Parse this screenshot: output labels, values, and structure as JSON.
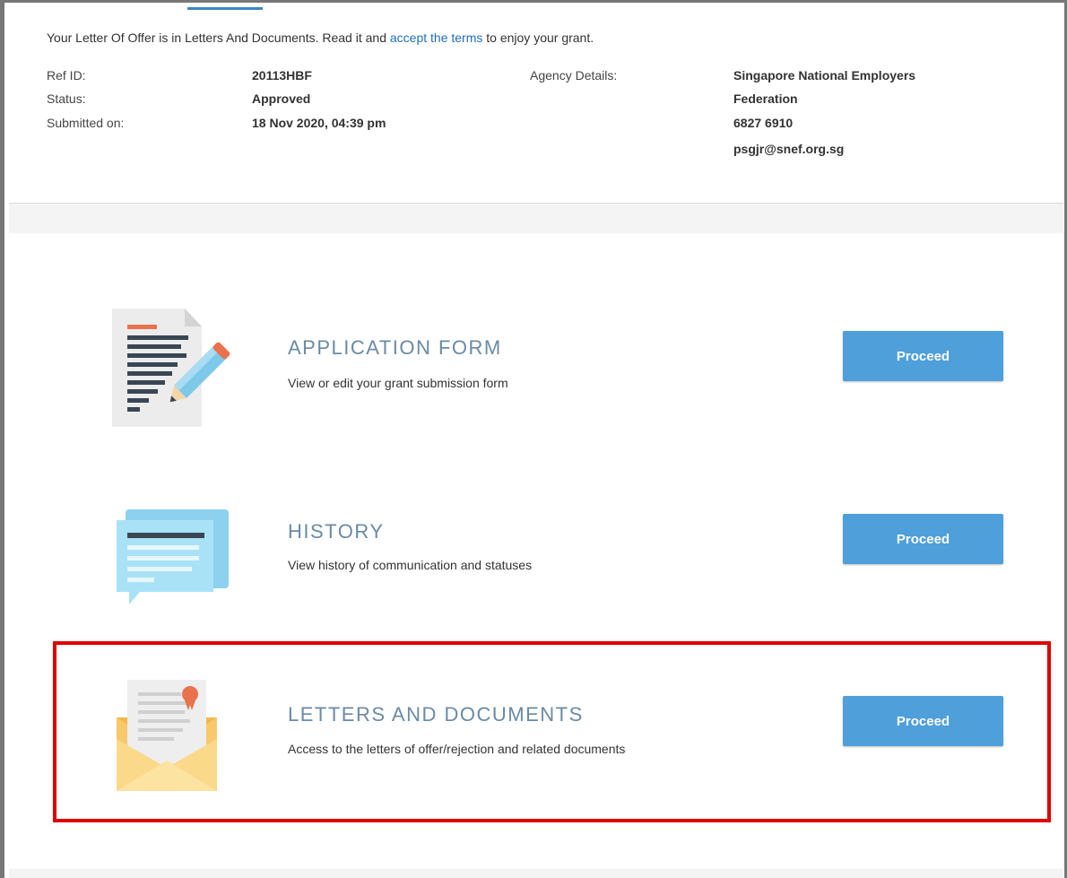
{
  "notice": {
    "prefix": "Your Letter Of Offer is in Letters And Documents. Read it and ",
    "link": "accept the terms",
    "suffix": " to enjoy your grant."
  },
  "details": {
    "ref_label": "Ref ID:",
    "ref_value": "20113HBF",
    "status_label": "Status:",
    "status_value": "Approved",
    "submitted_label": "Submitted on:",
    "submitted_value": "18 Nov 2020, 04:39 pm",
    "agency_label": "Agency Details:",
    "agency_name_line1": "Singapore National Employers",
    "agency_name_line2": "Federation",
    "agency_phone": "6827 6910",
    "agency_email": "psgjr@snef.org.sg"
  },
  "items": [
    {
      "title": "APPLICATION FORM",
      "description": "View or edit your grant submission form",
      "button": "Proceed",
      "icon": "document-pencil-icon"
    },
    {
      "title": "HISTORY",
      "description": "View history of communication and statuses",
      "button": "Proceed",
      "icon": "chat-bubble-icon"
    },
    {
      "title": "LETTERS AND DOCUMENTS",
      "description": "Access to the letters of offer/rejection and related documents",
      "button": "Proceed",
      "icon": "envelope-letter-icon"
    }
  ],
  "colors": {
    "accent": "#4f9fdb",
    "title": "#6a8aa7",
    "link": "#1f6fbf",
    "highlight": "#e00000"
  }
}
